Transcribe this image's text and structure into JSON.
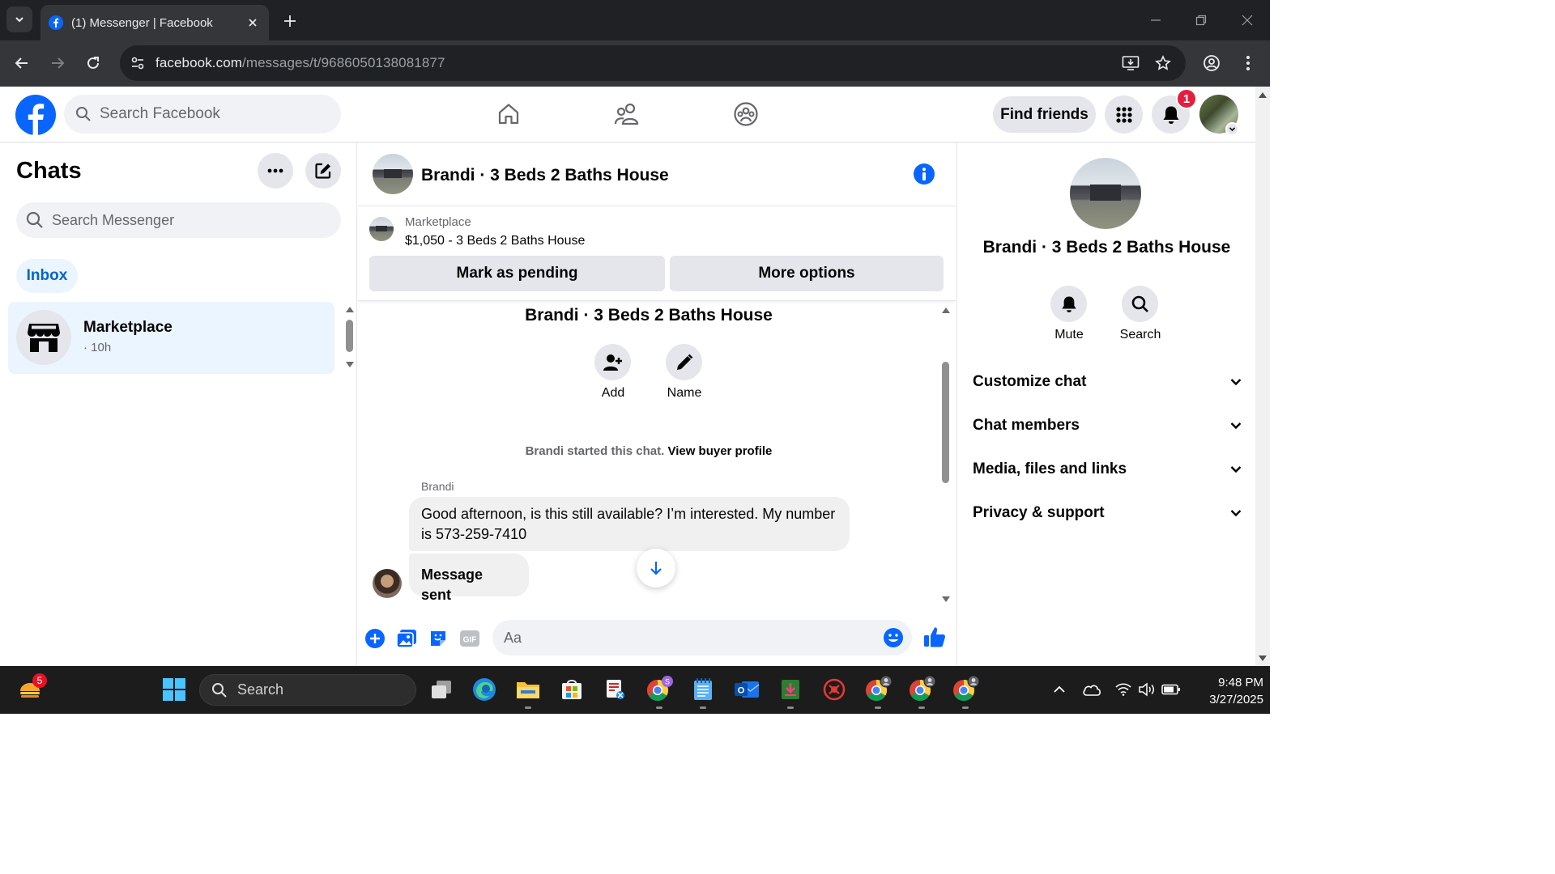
{
  "browser": {
    "tab_title": "(1) Messenger | Facebook",
    "url_host": "facebook.com",
    "url_path": "/messages/t/9686050138081877"
  },
  "fb_header": {
    "search_placeholder": "Search Facebook",
    "find_friends_label": "Find friends",
    "notification_count": "1",
    "brand_color": "#0866ff"
  },
  "sidebar": {
    "title": "Chats",
    "search_placeholder": "Search Messenger",
    "filter_label": "Inbox",
    "chats": [
      {
        "name": "Marketplace",
        "time": "· 10h"
      }
    ]
  },
  "conversation": {
    "title": "Brandi · 3 Beds 2 Baths House",
    "marketplace_label": "Marketplace",
    "listing": "$1,050 - 3 Beds 2 Baths House",
    "mark_pending_label": "Mark as pending",
    "more_options_label": "More options",
    "intro_title": "Brandi · 3 Beds 2 Baths House",
    "add_label": "Add",
    "name_label": "Name",
    "started_text": "Brandi started this chat.",
    "view_profile_label": "View buyer profile",
    "messages": [
      {
        "sender": "Brandi",
        "text": "Good afternoon, is this still available? I’m interested. My number is 573-259-7410"
      },
      {
        "sender": "",
        "text": "Message sent"
      }
    ],
    "composer_placeholder": "Aa"
  },
  "details": {
    "title": "Brandi · 3 Beds 2 Baths House",
    "mute_label": "Mute",
    "search_label": "Search",
    "sections": [
      {
        "label": "Customize chat"
      },
      {
        "label": "Chat members"
      },
      {
        "label": "Media, files and links"
      },
      {
        "label": "Privacy & support"
      }
    ]
  },
  "taskbar": {
    "search_label": "Search",
    "time": "9:48 PM",
    "date": "3/27/2025",
    "widget_badge": "5"
  }
}
